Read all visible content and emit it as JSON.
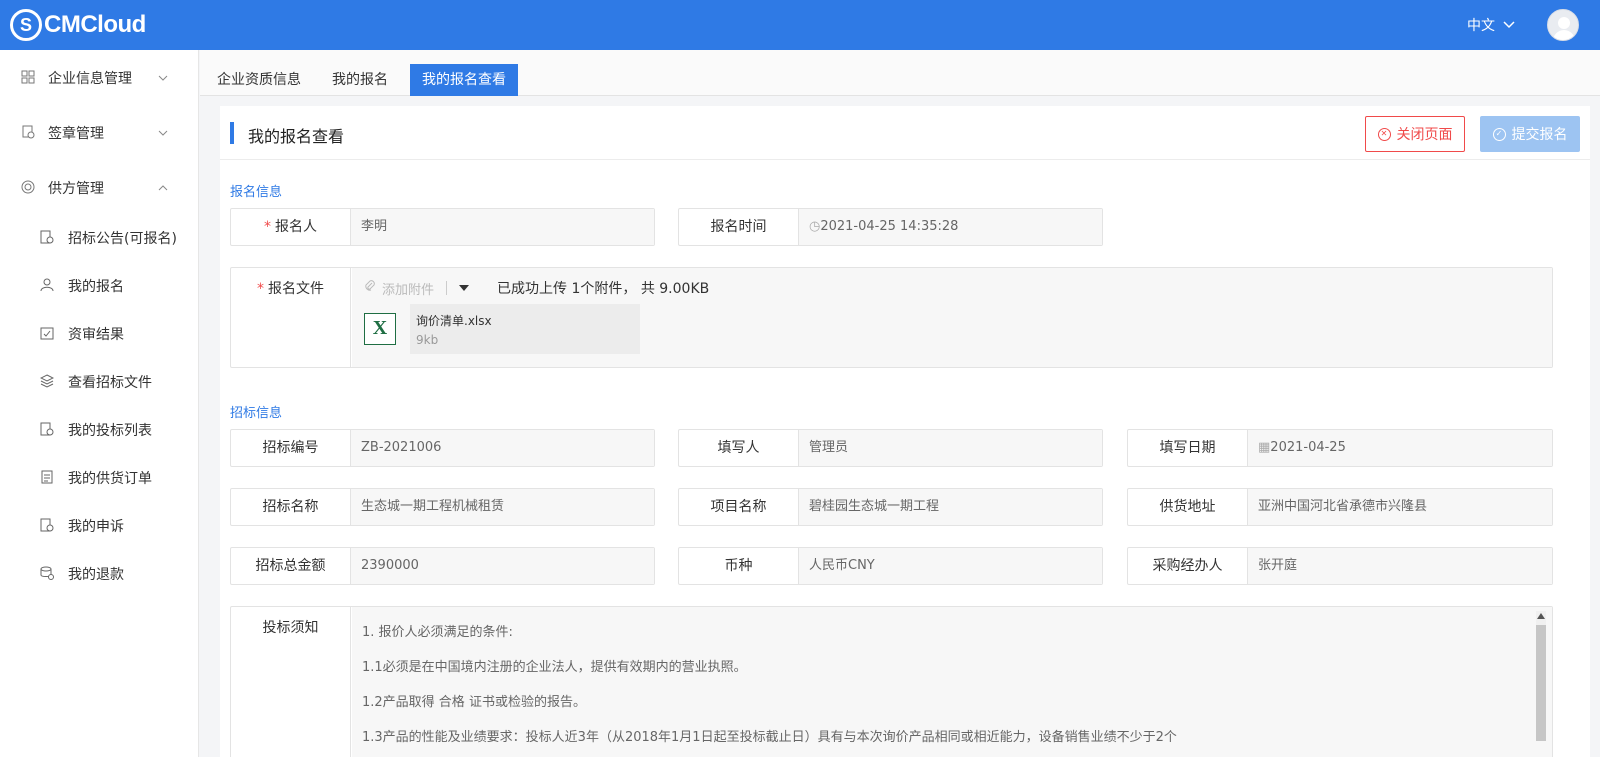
{
  "header": {
    "logo_mark": "S",
    "logo_text": "CMCloud",
    "language": "中文",
    "language_icon": "chevron-down-icon"
  },
  "sidebar": {
    "groups": [
      {
        "label": "企业信息管理",
        "icon": "grid-icon",
        "expanded": false
      },
      {
        "label": "签章管理",
        "icon": "seal-icon",
        "expanded": false
      },
      {
        "label": "供方管理",
        "icon": "target-icon",
        "expanded": true
      }
    ],
    "items": [
      {
        "label": "招标公告(可报名)",
        "icon": "announcement-icon"
      },
      {
        "label": "我的报名",
        "icon": "user-icon"
      },
      {
        "label": "资审结果",
        "icon": "clipboard-check-icon"
      },
      {
        "label": "查看招标文件",
        "icon": "layers-icon"
      },
      {
        "label": "我的投标列表",
        "icon": "bid-list-icon"
      },
      {
        "label": "我的供货订单",
        "icon": "order-icon"
      },
      {
        "label": "我的申诉",
        "icon": "appeal-icon"
      },
      {
        "label": "我的退款",
        "icon": "refund-icon"
      }
    ]
  },
  "tabs": [
    {
      "label": "企业资质信息",
      "active": false
    },
    {
      "label": "我的报名",
      "active": false
    },
    {
      "label": "我的报名查看",
      "active": true
    }
  ],
  "page": {
    "title": "我的报名查看",
    "close_button": "关闭页面",
    "submit_button": "提交报名"
  },
  "registration": {
    "section_title": "报名信息",
    "registrant_label": "报名人",
    "registrant_value": "李明",
    "time_label": "报名时间",
    "time_value": "2021-04-25 14:35:28",
    "file_label": "报名文件",
    "add_attachment": "添加附件",
    "upload_status": "已成功上传 1个附件， 共 9.00KB",
    "file_icon_letter": "X",
    "file_name": "询价清单.xlsx",
    "file_size": "9kb"
  },
  "tender": {
    "section_title": "招标信息",
    "fields": [
      {
        "label": "招标编号",
        "value": "ZB-2021006"
      },
      {
        "label": "填写人",
        "value": "管理员"
      },
      {
        "label": "填写日期",
        "value": "2021-04-25"
      },
      {
        "label": "招标名称",
        "value": "生态城一期工程机械租赁"
      },
      {
        "label": "项目名称",
        "value": "碧桂园生态城一期工程"
      },
      {
        "label": "供货地址",
        "value": "亚洲中国河北省承德市兴隆县"
      },
      {
        "label": "招标总金额",
        "value": "2390000"
      },
      {
        "label": "币种",
        "value": "人民币CNY"
      },
      {
        "label": "采购经办人",
        "value": "张开庭"
      }
    ],
    "notice_label": "投标须知",
    "notice_lines": [
      "1. 报价人必须满足的条件:",
      "1.1必须是在中国境内注册的企业法人，提供有效期内的营业执照。",
      "1.2产品取得 合格  证书或检验的报告。",
      "1.3产品的性能及业绩要求：投标人近3年（从2018年1月1日起至投标截止日）具有与本次询价产品相同或相近能力，设备销售业绩不少于2个"
    ]
  },
  "colors": {
    "primary": "#2f7ae5",
    "danger": "#f04a4a",
    "submit_disabled": "#9dc4f2",
    "excel_green": "#1f6e43"
  }
}
